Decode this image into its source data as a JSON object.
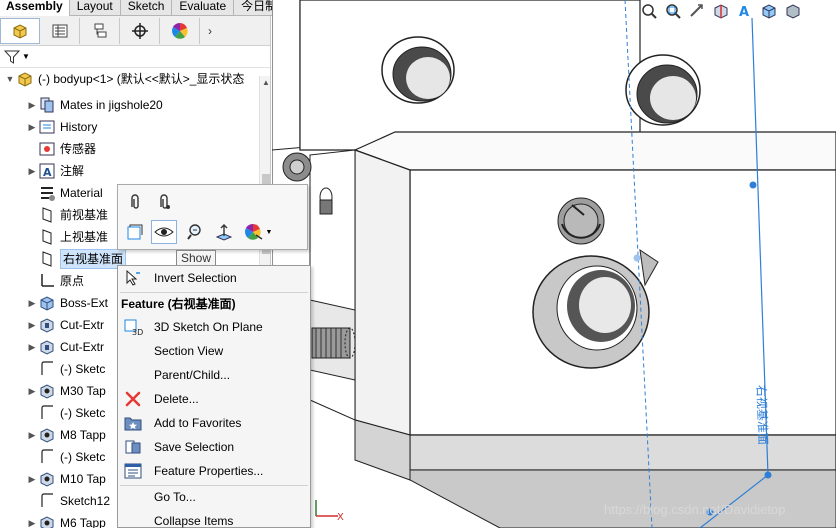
{
  "command_tabs": [
    "Assembly",
    "Layout",
    "Sketch",
    "Evaluate",
    "今日制造"
  ],
  "tree": {
    "root_label": "(-) bodyup<1> (默认<<默认>_显示状态",
    "items": [
      {
        "label": "Mates in jigshole20",
        "icon": "mates-icon"
      },
      {
        "label": "History",
        "icon": "history-icon"
      },
      {
        "label": "传感器",
        "icon": "sensor-icon"
      },
      {
        "label": "注解",
        "icon": "annotation-icon"
      },
      {
        "label": "Material",
        "icon": "material-icon"
      },
      {
        "label": "前视基准",
        "icon": "plane-icon"
      },
      {
        "label": "上视基准",
        "icon": "plane-icon"
      },
      {
        "label": "右视基准面",
        "icon": "plane-icon"
      },
      {
        "label": "原点",
        "icon": "origin-icon"
      },
      {
        "label": "Boss-Ext",
        "icon": "boss-extrude-icon"
      },
      {
        "label": "Cut-Extr",
        "icon": "cut-extrude-icon"
      },
      {
        "label": "Cut-Extr",
        "icon": "cut-extrude-icon"
      },
      {
        "label": "(-) Sketc",
        "icon": "sketch-icon"
      },
      {
        "label": "M30 Tap",
        "icon": "hole-wizard-icon"
      },
      {
        "label": "(-) Sketc",
        "icon": "sketch-icon"
      },
      {
        "label": "M8 Tapp",
        "icon": "hole-wizard-icon"
      },
      {
        "label": "(-) Sketc",
        "icon": "sketch-icon"
      },
      {
        "label": "M10 Tap",
        "icon": "hole-wizard-icon"
      },
      {
        "label": "Sketch12",
        "icon": "sketch-icon"
      },
      {
        "label": "M6 Tapp",
        "icon": "hole-wizard-icon"
      }
    ]
  },
  "context_toolbar": {
    "tooltip": "Show"
  },
  "context_menu": {
    "header": "Feature (右视基准面)",
    "items": [
      {
        "label": "Invert Selection",
        "icon": "invert-selection-icon"
      },
      {
        "label": "3D Sketch On Plane",
        "icon": "3d-sketch-icon"
      },
      {
        "label": "Section View",
        "icon": ""
      },
      {
        "label": "Parent/Child...",
        "icon": ""
      },
      {
        "label": "Delete...",
        "icon": "delete-icon"
      },
      {
        "label": "Add to Favorites",
        "icon": "favorites-icon"
      },
      {
        "label": "Save Selection",
        "icon": "save-selection-icon"
      },
      {
        "label": "Feature Properties...",
        "icon": "properties-icon"
      },
      {
        "label": "Go To...",
        "icon": ""
      },
      {
        "label": "Collapse Items",
        "icon": ""
      }
    ]
  },
  "watermark": "https://blog.csdn.net/Davidietop",
  "colors": {
    "accent": "#3a78c4",
    "selection": "#cfe3fb",
    "plane_line": "#2e7fd6"
  }
}
